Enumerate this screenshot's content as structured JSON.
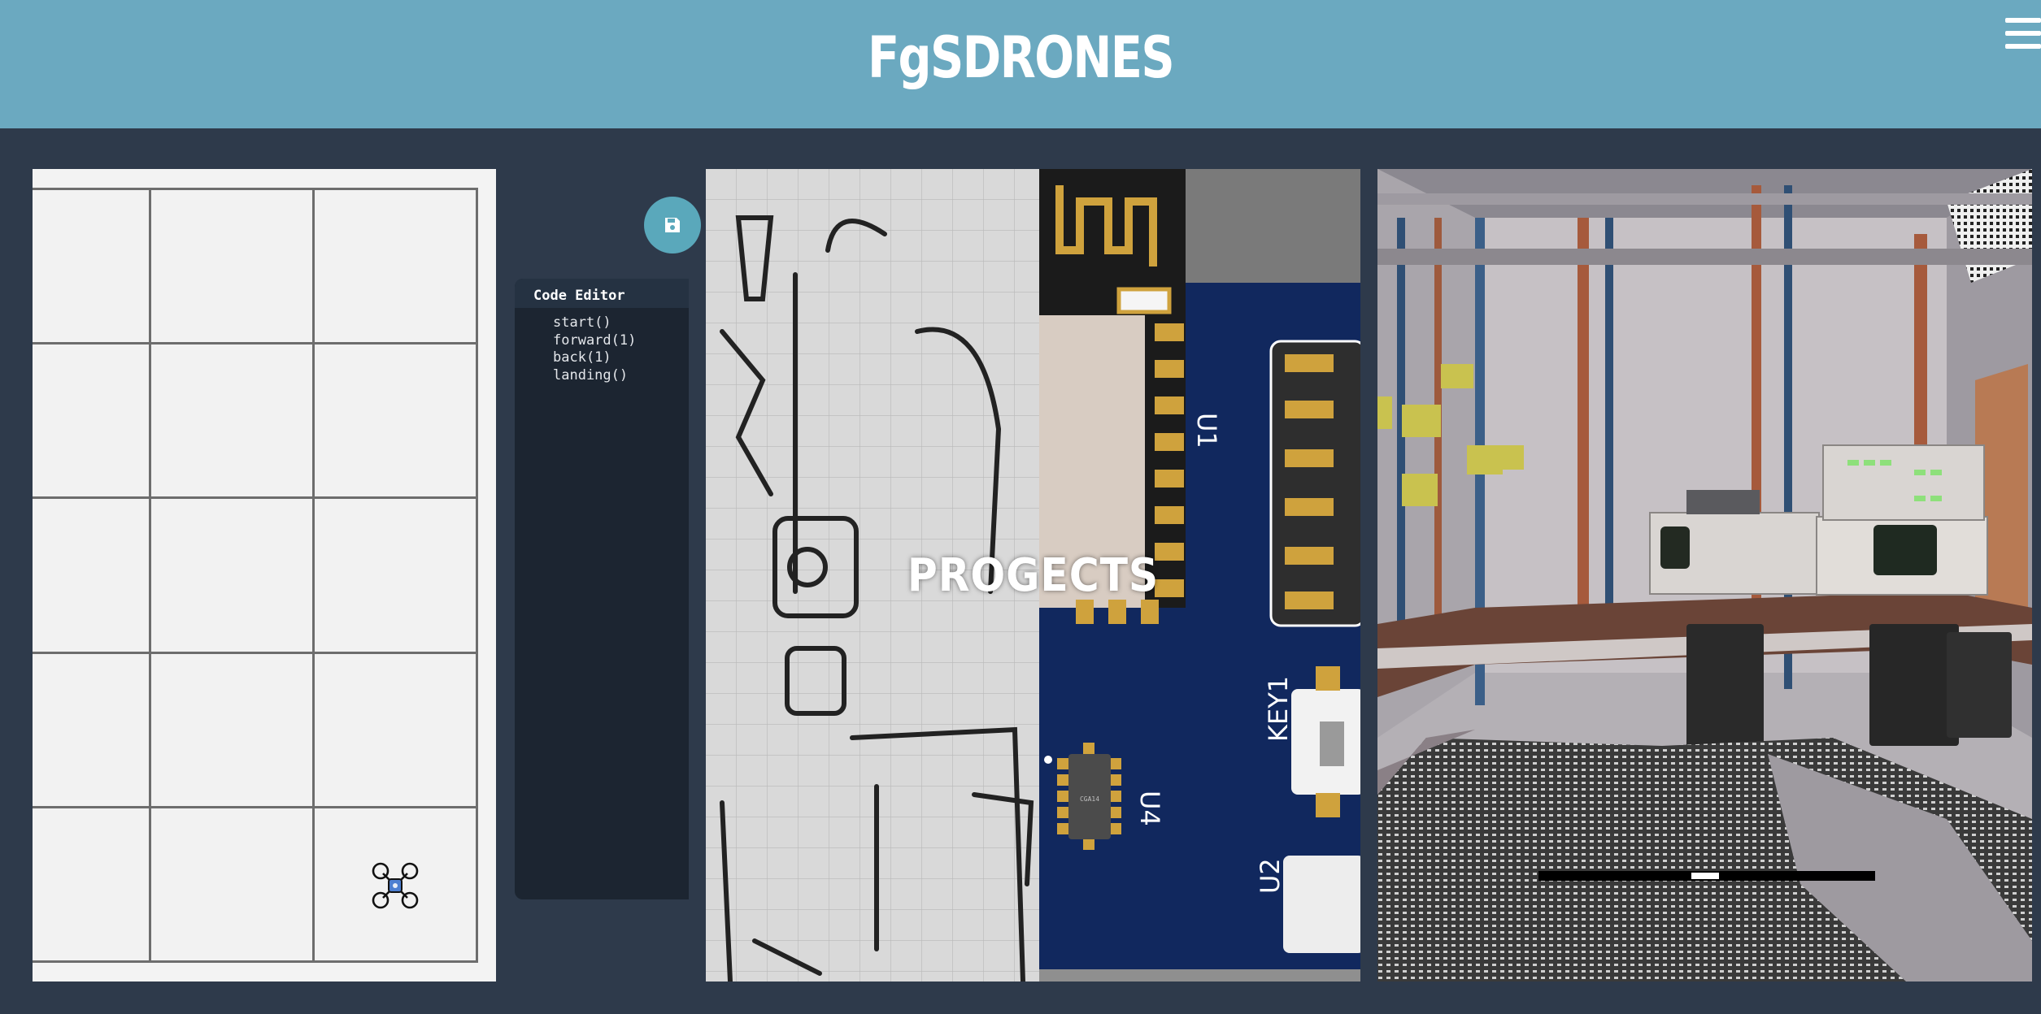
{
  "header": {
    "brand": "FgSDRONES"
  },
  "icons": {
    "menu": "hamburger-menu-icon",
    "save": "floppy-disk-icon",
    "drone": "drone-icon"
  },
  "grid": {
    "rows": 5,
    "cols": 3,
    "drone_cell": {
      "row": 4,
      "col": 2
    }
  },
  "editor": {
    "title": "Code Editor",
    "lines": [
      "start()",
      "forward(1)",
      "back(1)",
      "landing()"
    ]
  },
  "projects": {
    "label": "PROGECTS",
    "pcb_labels": [
      "U1",
      "KEY1",
      "U4",
      "U2"
    ],
    "chip_text": "CGA14"
  },
  "colors": {
    "header": "#6ba9c0",
    "background": "#2e3a4b",
    "editor": "#1c2531",
    "save_button": "#5aa8bb",
    "pcb": "#11285e",
    "pad_gold": "#cfa23d"
  }
}
